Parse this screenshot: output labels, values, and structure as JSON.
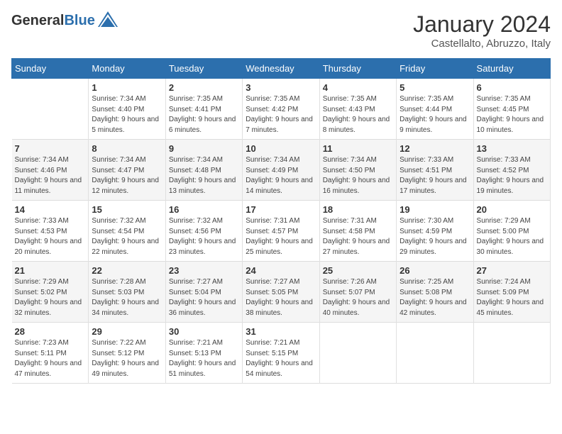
{
  "header": {
    "logo_general": "General",
    "logo_blue": "Blue",
    "month_year": "January 2024",
    "location": "Castellalto, Abruzzo, Italy"
  },
  "days_of_week": [
    "Sunday",
    "Monday",
    "Tuesday",
    "Wednesday",
    "Thursday",
    "Friday",
    "Saturday"
  ],
  "weeks": [
    [
      {
        "num": "",
        "sunrise": "",
        "sunset": "",
        "daylight": ""
      },
      {
        "num": "1",
        "sunrise": "Sunrise: 7:34 AM",
        "sunset": "Sunset: 4:40 PM",
        "daylight": "Daylight: 9 hours and 5 minutes."
      },
      {
        "num": "2",
        "sunrise": "Sunrise: 7:35 AM",
        "sunset": "Sunset: 4:41 PM",
        "daylight": "Daylight: 9 hours and 6 minutes."
      },
      {
        "num": "3",
        "sunrise": "Sunrise: 7:35 AM",
        "sunset": "Sunset: 4:42 PM",
        "daylight": "Daylight: 9 hours and 7 minutes."
      },
      {
        "num": "4",
        "sunrise": "Sunrise: 7:35 AM",
        "sunset": "Sunset: 4:43 PM",
        "daylight": "Daylight: 9 hours and 8 minutes."
      },
      {
        "num": "5",
        "sunrise": "Sunrise: 7:35 AM",
        "sunset": "Sunset: 4:44 PM",
        "daylight": "Daylight: 9 hours and 9 minutes."
      },
      {
        "num": "6",
        "sunrise": "Sunrise: 7:35 AM",
        "sunset": "Sunset: 4:45 PM",
        "daylight": "Daylight: 9 hours and 10 minutes."
      }
    ],
    [
      {
        "num": "7",
        "sunrise": "Sunrise: 7:34 AM",
        "sunset": "Sunset: 4:46 PM",
        "daylight": "Daylight: 9 hours and 11 minutes."
      },
      {
        "num": "8",
        "sunrise": "Sunrise: 7:34 AM",
        "sunset": "Sunset: 4:47 PM",
        "daylight": "Daylight: 9 hours and 12 minutes."
      },
      {
        "num": "9",
        "sunrise": "Sunrise: 7:34 AM",
        "sunset": "Sunset: 4:48 PM",
        "daylight": "Daylight: 9 hours and 13 minutes."
      },
      {
        "num": "10",
        "sunrise": "Sunrise: 7:34 AM",
        "sunset": "Sunset: 4:49 PM",
        "daylight": "Daylight: 9 hours and 14 minutes."
      },
      {
        "num": "11",
        "sunrise": "Sunrise: 7:34 AM",
        "sunset": "Sunset: 4:50 PM",
        "daylight": "Daylight: 9 hours and 16 minutes."
      },
      {
        "num": "12",
        "sunrise": "Sunrise: 7:33 AM",
        "sunset": "Sunset: 4:51 PM",
        "daylight": "Daylight: 9 hours and 17 minutes."
      },
      {
        "num": "13",
        "sunrise": "Sunrise: 7:33 AM",
        "sunset": "Sunset: 4:52 PM",
        "daylight": "Daylight: 9 hours and 19 minutes."
      }
    ],
    [
      {
        "num": "14",
        "sunrise": "Sunrise: 7:33 AM",
        "sunset": "Sunset: 4:53 PM",
        "daylight": "Daylight: 9 hours and 20 minutes."
      },
      {
        "num": "15",
        "sunrise": "Sunrise: 7:32 AM",
        "sunset": "Sunset: 4:54 PM",
        "daylight": "Daylight: 9 hours and 22 minutes."
      },
      {
        "num": "16",
        "sunrise": "Sunrise: 7:32 AM",
        "sunset": "Sunset: 4:56 PM",
        "daylight": "Daylight: 9 hours and 23 minutes."
      },
      {
        "num": "17",
        "sunrise": "Sunrise: 7:31 AM",
        "sunset": "Sunset: 4:57 PM",
        "daylight": "Daylight: 9 hours and 25 minutes."
      },
      {
        "num": "18",
        "sunrise": "Sunrise: 7:31 AM",
        "sunset": "Sunset: 4:58 PM",
        "daylight": "Daylight: 9 hours and 27 minutes."
      },
      {
        "num": "19",
        "sunrise": "Sunrise: 7:30 AM",
        "sunset": "Sunset: 4:59 PM",
        "daylight": "Daylight: 9 hours and 29 minutes."
      },
      {
        "num": "20",
        "sunrise": "Sunrise: 7:29 AM",
        "sunset": "Sunset: 5:00 PM",
        "daylight": "Daylight: 9 hours and 30 minutes."
      }
    ],
    [
      {
        "num": "21",
        "sunrise": "Sunrise: 7:29 AM",
        "sunset": "Sunset: 5:02 PM",
        "daylight": "Daylight: 9 hours and 32 minutes."
      },
      {
        "num": "22",
        "sunrise": "Sunrise: 7:28 AM",
        "sunset": "Sunset: 5:03 PM",
        "daylight": "Daylight: 9 hours and 34 minutes."
      },
      {
        "num": "23",
        "sunrise": "Sunrise: 7:27 AM",
        "sunset": "Sunset: 5:04 PM",
        "daylight": "Daylight: 9 hours and 36 minutes."
      },
      {
        "num": "24",
        "sunrise": "Sunrise: 7:27 AM",
        "sunset": "Sunset: 5:05 PM",
        "daylight": "Daylight: 9 hours and 38 minutes."
      },
      {
        "num": "25",
        "sunrise": "Sunrise: 7:26 AM",
        "sunset": "Sunset: 5:07 PM",
        "daylight": "Daylight: 9 hours and 40 minutes."
      },
      {
        "num": "26",
        "sunrise": "Sunrise: 7:25 AM",
        "sunset": "Sunset: 5:08 PM",
        "daylight": "Daylight: 9 hours and 42 minutes."
      },
      {
        "num": "27",
        "sunrise": "Sunrise: 7:24 AM",
        "sunset": "Sunset: 5:09 PM",
        "daylight": "Daylight: 9 hours and 45 minutes."
      }
    ],
    [
      {
        "num": "28",
        "sunrise": "Sunrise: 7:23 AM",
        "sunset": "Sunset: 5:11 PM",
        "daylight": "Daylight: 9 hours and 47 minutes."
      },
      {
        "num": "29",
        "sunrise": "Sunrise: 7:22 AM",
        "sunset": "Sunset: 5:12 PM",
        "daylight": "Daylight: 9 hours and 49 minutes."
      },
      {
        "num": "30",
        "sunrise": "Sunrise: 7:21 AM",
        "sunset": "Sunset: 5:13 PM",
        "daylight": "Daylight: 9 hours and 51 minutes."
      },
      {
        "num": "31",
        "sunrise": "Sunrise: 7:21 AM",
        "sunset": "Sunset: 5:15 PM",
        "daylight": "Daylight: 9 hours and 54 minutes."
      },
      {
        "num": "",
        "sunrise": "",
        "sunset": "",
        "daylight": ""
      },
      {
        "num": "",
        "sunrise": "",
        "sunset": "",
        "daylight": ""
      },
      {
        "num": "",
        "sunrise": "",
        "sunset": "",
        "daylight": ""
      }
    ]
  ]
}
